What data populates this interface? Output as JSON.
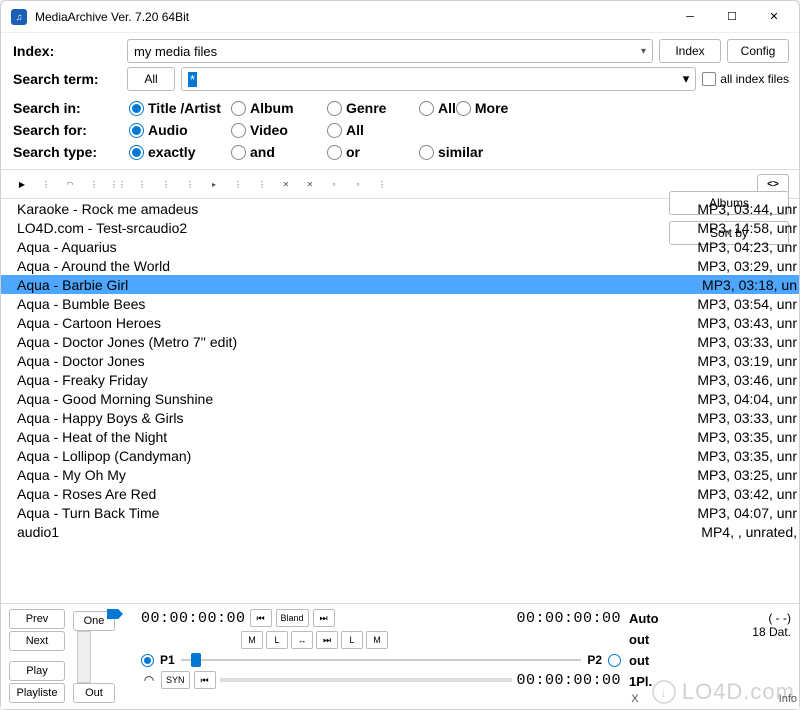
{
  "title": "MediaArchive Ver. 7.20 64Bit",
  "index": {
    "label": "Index:",
    "value": "my media files",
    "btn_index": "Index",
    "btn_config": "Config"
  },
  "search": {
    "label": "Search term:",
    "filter": "All",
    "value": "*",
    "chk_label": "all index files"
  },
  "searchin": {
    "label": "Search in:",
    "opts": [
      "Title /Artist",
      "Album",
      "Genre",
      "All",
      "More"
    ],
    "sel": 0
  },
  "searchfor": {
    "label": "Search for:",
    "opts": [
      "Audio",
      "Video",
      "All",
      "",
      ""
    ],
    "sel": 0
  },
  "searchtype": {
    "label": "Search type:",
    "opts": [
      "exactly",
      "and",
      "or",
      "similar",
      ""
    ],
    "sel": 0
  },
  "btn_albums": "Albums",
  "btn_sortby": "Sort by",
  "expand": "<>",
  "rows": [
    {
      "name": "Karaoke - Rock me amadeus",
      "meta": "MP3, 03:44, unr",
      "sel": false
    },
    {
      "name": "LO4D.com - Test-srcaudio2",
      "meta": "MP3, 14:58, unr",
      "sel": false
    },
    {
      "name": "Aqua - Aquarius",
      "meta": "MP3, 04:23, unr",
      "sel": false
    },
    {
      "name": "Aqua - Around the World",
      "meta": "MP3, 03:29, unr",
      "sel": false
    },
    {
      "name": "Aqua - Barbie Girl",
      "meta": "MP3, 03:18, un",
      "sel": true
    },
    {
      "name": "Aqua - Bumble Bees",
      "meta": "MP3, 03:54, unr",
      "sel": false
    },
    {
      "name": "Aqua - Cartoon Heroes",
      "meta": "MP3, 03:43, unr",
      "sel": false
    },
    {
      "name": "Aqua - Doctor Jones (Metro 7'' edit)",
      "meta": "MP3, 03:33, unr",
      "sel": false
    },
    {
      "name": "Aqua - Doctor Jones",
      "meta": "MP3, 03:19, unr",
      "sel": false
    },
    {
      "name": "Aqua - Freaky Friday",
      "meta": "MP3, 03:46, unr",
      "sel": false
    },
    {
      "name": "Aqua - Good Morning Sunshine",
      "meta": "MP3, 04:04, unr",
      "sel": false
    },
    {
      "name": "Aqua - Happy Boys & Girls",
      "meta": "MP3, 03:33, unr",
      "sel": false
    },
    {
      "name": "Aqua - Heat of the Night",
      "meta": "MP3, 03:35, unr",
      "sel": false
    },
    {
      "name": "Aqua - Lollipop (Candyman)",
      "meta": "MP3, 03:35, unr",
      "sel": false
    },
    {
      "name": "Aqua - My Oh My",
      "meta": "MP3, 03:25, unr",
      "sel": false
    },
    {
      "name": "Aqua - Roses Are Red",
      "meta": "MP3, 03:42, unr",
      "sel": false
    },
    {
      "name": "Aqua - Turn Back Time",
      "meta": "MP3, 04:07, unr",
      "sel": false
    },
    {
      "name": "audio1",
      "meta": "MP4, , unrated,",
      "sel": false
    }
  ],
  "bottom": {
    "prev": "Prev",
    "next": "Next",
    "play": "Play",
    "playliste": "Playliste",
    "one": "One",
    "out": "Out",
    "tc1": "00:00:00:00",
    "tc2": "00:00:00:00",
    "tc3": "00:00:00:00",
    "bland": "Bland",
    "M": "M",
    "L": "L",
    "syn": "SYN",
    "p1": "P1",
    "p2": "P2",
    "auto": "Auto",
    "out2": "out",
    "out3": "out",
    "pl1": "1Pl.",
    "dash": "( - -)",
    "dat": "18 Dat.",
    "x": "X",
    "info": "Info"
  },
  "watermark": "LO4D.com"
}
